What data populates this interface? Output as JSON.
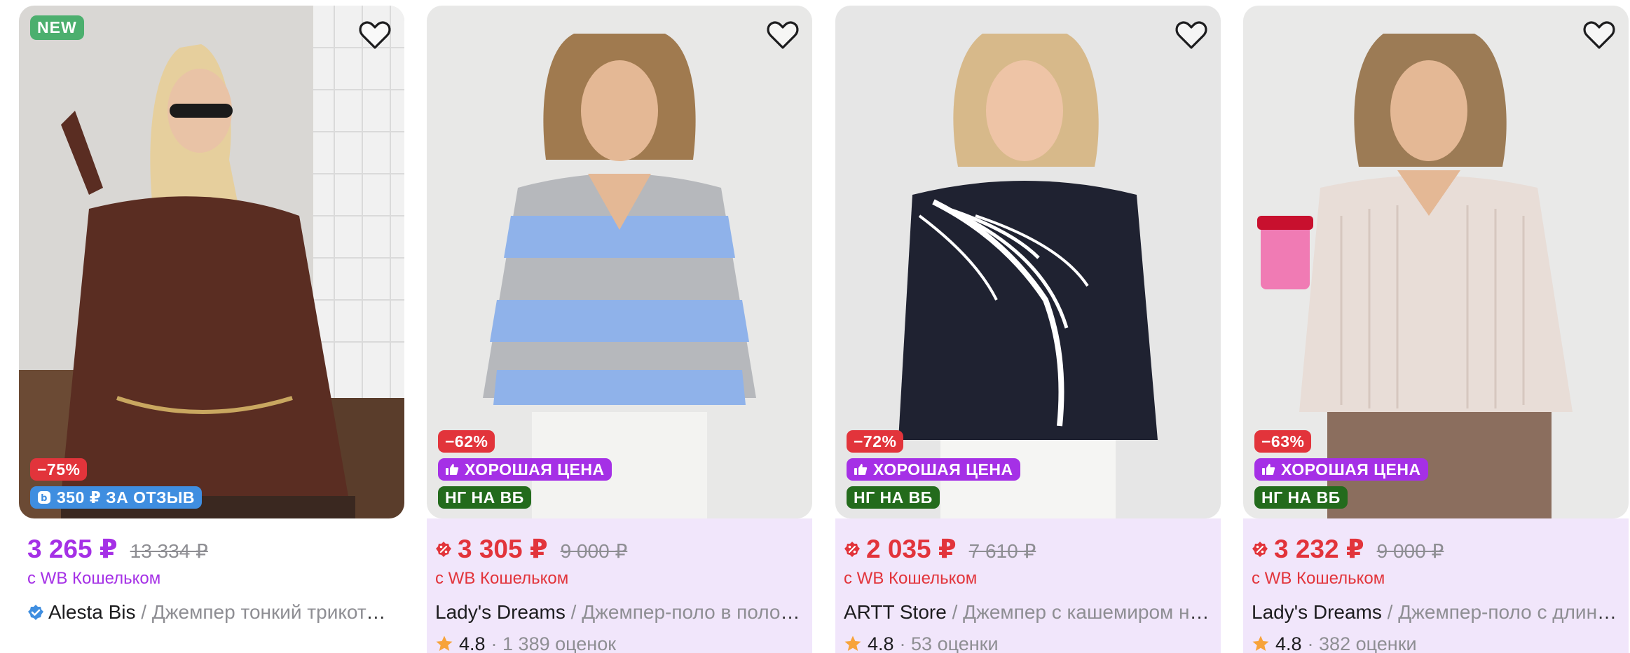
{
  "currency": "₽",
  "products": [
    {
      "new_label": "NEW",
      "discount": "−75%",
      "review_badge": "350 ₽ ЗА ОТЗЫВ",
      "price": "3 265 ₽",
      "old_price": "13 334 ₽",
      "wallet_text": "с WB Кошельком",
      "brand": "Alesta Bis",
      "separator": " / ",
      "name": "Джемпер тонкий трикотажный",
      "verified": true,
      "price_color": "#a530e6"
    },
    {
      "discount": "−62%",
      "good_price": "ХОРОШАЯ ЦЕНА",
      "ng_badge": "НГ НА ВБ",
      "price": "3 305 ₽",
      "old_price": "9 000 ₽",
      "wallet_text": "с WB Кошельком",
      "brand": "Lady's Dreams",
      "separator": " / ",
      "name": "Джемпер-поло в полоску",
      "rating": "4.8",
      "reviews": "· 1 389 оценок",
      "price_color": "#e2343b"
    },
    {
      "discount": "−72%",
      "good_price": "ХОРОШАЯ ЦЕНА",
      "ng_badge": "НГ НА ВБ",
      "price": "2 035 ₽",
      "old_price": "7 610 ₽",
      "wallet_text": "с WB Кошельком",
      "brand": "ARTT Store",
      "separator": " / ",
      "name": "Джемпер с кашемиром на осень",
      "rating": "4.8",
      "reviews": "· 53 оценки",
      "price_color": "#e2343b"
    },
    {
      "discount": "−63%",
      "good_price": "ХОРОШАЯ ЦЕНА",
      "ng_badge": "НГ НА ВБ",
      "price": "3 232 ₽",
      "old_price": "9 000 ₽",
      "wallet_text": "с WB Кошельком",
      "brand": "Lady's Dreams",
      "separator": " / ",
      "name": "Джемпер-поло с длинным рукавом",
      "rating": "4.8",
      "reviews": "· 382 оценки",
      "price_color": "#e2343b"
    }
  ],
  "icons": {
    "favorite": "heart-icon",
    "verified": "verified-check-icon",
    "thumbs_up": "thumbs-up-icon",
    "percent": "percent-badge-icon",
    "star": "star-icon",
    "review": "wb-coin-icon"
  },
  "colors": {
    "purple": "#a530e6",
    "red": "#e2343b",
    "green_new": "#4caf6e",
    "dark_green": "#236b1c",
    "blue": "#3f8ee0",
    "promo_bg": "#f1e6fb",
    "star": "#f7a33a"
  }
}
